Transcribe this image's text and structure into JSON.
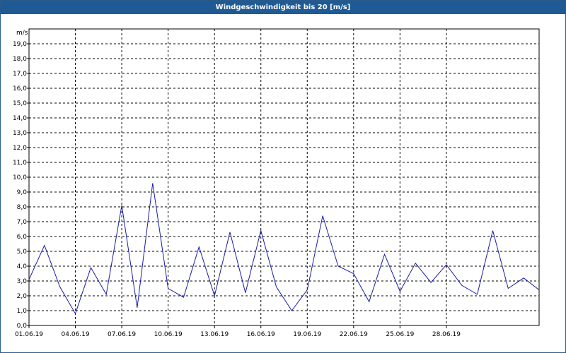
{
  "window": {
    "title": "Windgeschwindigkeit bis 20 [m/s]"
  },
  "chart_data": {
    "type": "line",
    "title": "Windgeschwindigkeit bis 20 [m/s]",
    "ylabel": "m/s",
    "xlabel": "",
    "ylim": [
      0,
      20
    ],
    "xlim": [
      "01.06.19",
      "04.07.19"
    ],
    "yticks": [
      "0,0",
      "1,0",
      "2,0",
      "3,0",
      "4,0",
      "5,0",
      "6,0",
      "7,0",
      "8,0",
      "9,0",
      "10,0",
      "11,0",
      "12,0",
      "13,0",
      "14,0",
      "15,0",
      "16,0",
      "17,0",
      "18,0",
      "19,0"
    ],
    "xticks": [
      "01.06.19",
      "04.06.19",
      "07.06.19",
      "10.06.19",
      "13.06.19",
      "16.06.19",
      "19.06.19",
      "22.06.19",
      "25.06.19",
      "28.06.19"
    ],
    "grid": true,
    "colors": {
      "series": "#1a1aaa",
      "grid": "#000000"
    },
    "series": [
      {
        "name": "",
        "x": [
          "01.06.19",
          "02.06.19",
          "03.06.19",
          "04.06.19",
          "05.06.19",
          "06.06.19",
          "07.06.19",
          "08.06.19",
          "09.06.19",
          "10.06.19",
          "11.06.19",
          "12.06.19",
          "13.06.19",
          "14.06.19",
          "15.06.19",
          "16.06.19",
          "17.06.19",
          "18.06.19",
          "19.06.19",
          "20.06.19",
          "21.06.19",
          "22.06.19",
          "23.06.19",
          "24.06.19",
          "25.06.19",
          "26.06.19",
          "27.06.19",
          "28.06.19",
          "29.06.19",
          "30.06.19",
          "01.07.19",
          "02.07.19",
          "03.07.19",
          "04.07.19"
        ],
        "values": [
          3.1,
          5.4,
          2.6,
          0.8,
          3.9,
          2.1,
          8.1,
          1.2,
          9.6,
          2.5,
          1.9,
          5.3,
          2.0,
          6.3,
          2.2,
          6.4,
          2.6,
          1.0,
          2.4,
          7.4,
          4.0,
          3.5,
          1.6,
          4.8,
          2.3,
          4.2,
          2.9,
          4.1,
          2.7,
          2.1,
          6.4,
          2.5,
          3.2,
          2.4
        ]
      }
    ]
  }
}
